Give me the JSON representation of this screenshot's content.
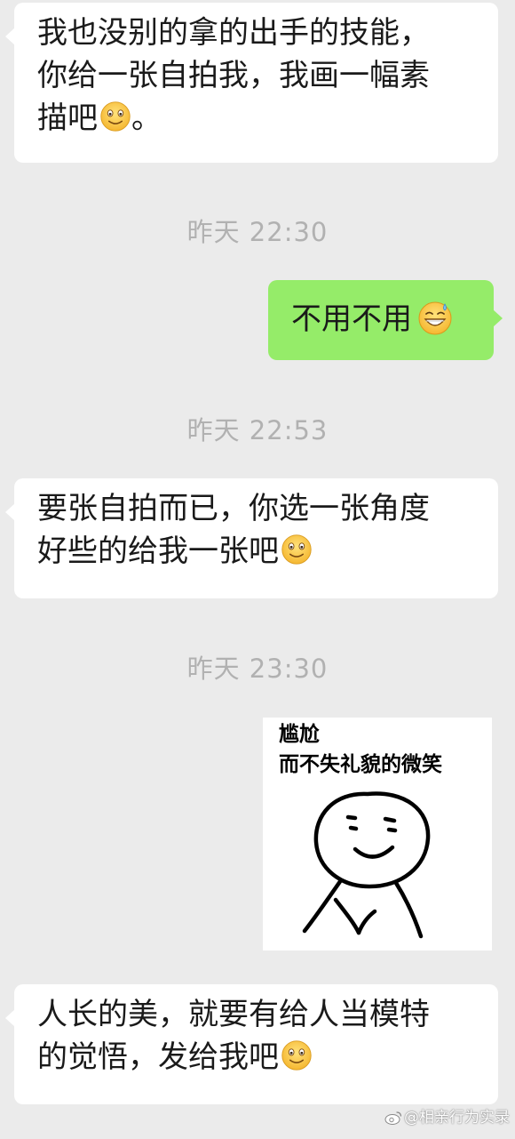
{
  "messages": [
    {
      "side": "left",
      "lines": [
        "我也没别的拿的出手的技能，",
        "你给一张自拍我，我画一幅素",
        "描吧"
      ],
      "tail_text": "。",
      "emoji": "smiling-face-icon"
    },
    {
      "side": "right",
      "text": "不用不用",
      "emoji": "sweat-smile-icon"
    },
    {
      "side": "left",
      "lines": [
        "要张自拍而已，你选一张角度",
        "好些的给我一张吧"
      ],
      "emoji": "smiling-face-icon"
    },
    {
      "side": "left",
      "lines": [
        "人长的美，就要有给人当模特",
        "的觉悟，发给我吧"
      ],
      "emoji": "smiling-face-icon"
    }
  ],
  "timestamps": [
    "昨天 22:30",
    "昨天 22:53",
    "昨天 23:30"
  ],
  "sticker": {
    "caption_line1": "尴尬",
    "caption_line2": "而不失礼貌的微笑"
  },
  "watermark": {
    "text": "@相亲行为实录",
    "icon": "weibo-icon"
  },
  "colors": {
    "background": "#ebebeb",
    "incoming_bubble": "#ffffff",
    "outgoing_bubble": "#95ec69",
    "timestamp_text": "#b1b1b1"
  }
}
